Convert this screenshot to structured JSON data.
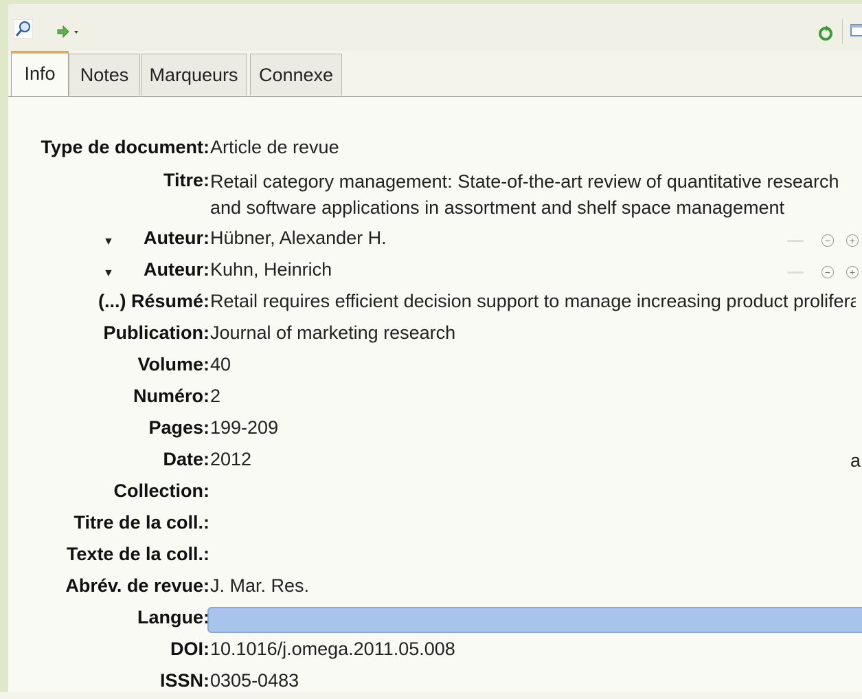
{
  "toolbar": {
    "icons": [
      "search-icon",
      "forward-arrow-icon",
      "refresh-icon",
      "window-icon"
    ]
  },
  "tabs": [
    {
      "label": "Info",
      "active": true
    },
    {
      "label": "Notes",
      "active": false
    },
    {
      "label": "Marqueurs",
      "active": false
    },
    {
      "label": "Connexe",
      "active": false
    }
  ],
  "fields": {
    "type": {
      "label": "Type de document:",
      "value": "Article de revue"
    },
    "titre": {
      "label": "Titre:",
      "value": "Retail category management: State-of-the-art review of quantitative research and software applications in assortment and shelf space management"
    },
    "auteur1": {
      "label": "Auteur:",
      "value": "Hübner, Alexander H."
    },
    "auteur2": {
      "label": "Auteur:",
      "value": "Kuhn, Heinrich"
    },
    "resume": {
      "label": "(...) Résumé:",
      "value": "Retail requires efficient decision support to manage increasing product prolifera..."
    },
    "publication": {
      "label": "Publication:",
      "value": "Journal of marketing research"
    },
    "volume": {
      "label": "Volume:",
      "value": "40"
    },
    "numero": {
      "label": "Numéro:",
      "value": "2"
    },
    "pages": {
      "label": "Pages:",
      "value": "199-209"
    },
    "date": {
      "label": "Date:",
      "value": "2012"
    },
    "collection": {
      "label": "Collection:",
      "value": ""
    },
    "titre_coll": {
      "label": "Titre de la coll.:",
      "value": ""
    },
    "texte_coll": {
      "label": "Texte de la coll.:",
      "value": ""
    },
    "abrev": {
      "label": "Abrév. de revue:",
      "value": "J. Mar. Res."
    },
    "langue": {
      "label": "Langue:",
      "value": ""
    },
    "doi": {
      "label": "DOI:",
      "value": "10.1016/j.omega.2011.05.008"
    },
    "issn": {
      "label": "ISSN:",
      "value": "0305-0483"
    }
  },
  "side_text": "a",
  "colors": {
    "accent_tab": "#f0b04a",
    "langue_highlight": "#a9c4ea",
    "frame": "#dfe8c8"
  }
}
